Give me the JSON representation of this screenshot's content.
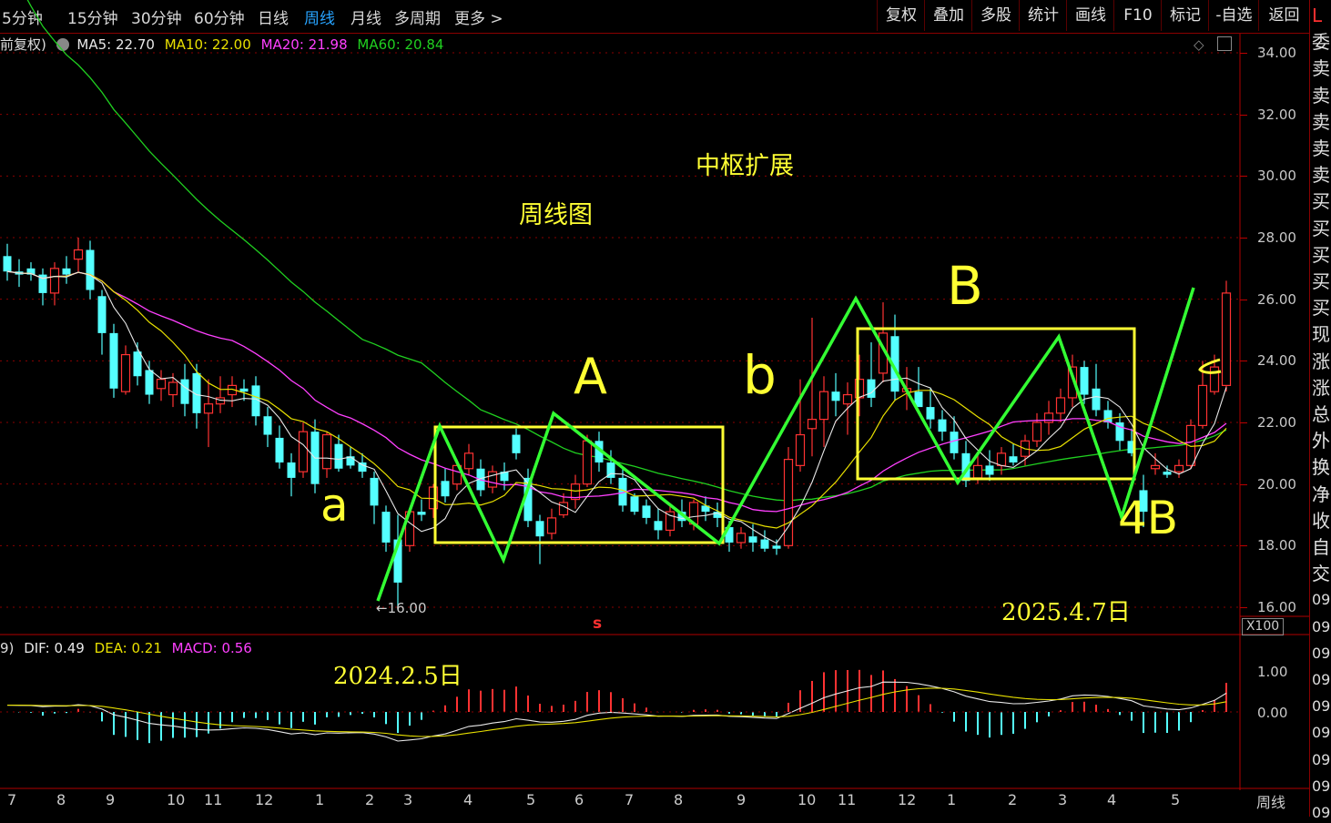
{
  "toolbar": {
    "periods": [
      {
        "label": "5分钟",
        "active": false
      },
      {
        "label": "15分钟",
        "active": false
      },
      {
        "label": "30分钟",
        "active": false
      },
      {
        "label": "60分钟",
        "active": false
      },
      {
        "label": "日线",
        "active": false
      },
      {
        "label": "周线",
        "active": true
      },
      {
        "label": "月线",
        "active": false
      },
      {
        "label": "多周期",
        "active": false
      },
      {
        "label": "更多 >",
        "active": false
      }
    ],
    "tools": [
      "复权",
      "叠加",
      "多股",
      "统计",
      "画线",
      "F10",
      "标记",
      "-自选",
      "返回"
    ]
  },
  "ma_legend": {
    "adjust_label": "前复权)",
    "ma5": "MA5: 22.70",
    "ma10": "MA10: 22.00",
    "ma20": "MA20: 21.98",
    "ma60": "MA60: 20.84"
  },
  "colors": {
    "up": "#ff3232",
    "down": "#54ffff",
    "ma5": "#e8e8e8",
    "ma10": "#e8e000",
    "ma20": "#ff40ff",
    "ma60": "#20d020",
    "grid": "#8a0000",
    "annotation_yellow": "#ffff33",
    "annotation_green": "#33ff33"
  },
  "price_axis": {
    "ticks": [
      "34.00",
      "32.00",
      "30.00",
      "28.00",
      "26.00",
      "24.00",
      "22.00",
      "20.00",
      "18.00",
      "16.00"
    ],
    "multiplier": "X100"
  },
  "low_marker": "16.00",
  "annotations": {
    "title1": "中枢扩展",
    "title2": "周线图",
    "label_A": "A",
    "label_B": "B",
    "label_a": "a",
    "label_b": "b",
    "label_c": "c",
    "label_4B": "4B",
    "date_start": "2024.2.5日",
    "date_end": "2025.4.7日",
    "s_marker": "s"
  },
  "macd": {
    "legend_prefix": "9)",
    "dif": "DIF: 0.49",
    "dea": "DEA: 0.21",
    "macd": "MACD: 0.56",
    "ticks": [
      "1.00",
      "0.00"
    ]
  },
  "x_axis": [
    "7",
    "8",
    "9",
    "10",
    "11",
    "12",
    "1",
    "2",
    "3",
    "4",
    "5",
    "6",
    "7",
    "8",
    "9",
    "10",
    "11",
    "12",
    "1",
    "2",
    "3",
    "4",
    "5"
  ],
  "period_label": "周线",
  "order_panel": [
    "L",
    "委",
    "卖",
    "卖",
    "卖",
    "卖",
    "卖",
    "买",
    "买",
    "买",
    "买",
    "买",
    "现",
    "涨",
    "涨",
    "总",
    "外",
    "换",
    "净",
    "收",
    "自",
    "交",
    "09",
    "09",
    "09",
    "09",
    "09",
    "09",
    "09",
    "09",
    "09"
  ],
  "chart_data": {
    "type": "candlestick",
    "period": "weekly",
    "ylim": [
      16,
      34
    ],
    "candles": [
      [
        27.4,
        27.8,
        26.6,
        26.9
      ],
      [
        26.9,
        27.3,
        26.4,
        26.8
      ],
      [
        27.0,
        27.2,
        26.6,
        26.8
      ],
      [
        26.8,
        27.0,
        25.8,
        26.2
      ],
      [
        26.2,
        27.2,
        25.8,
        27.0
      ],
      [
        27.0,
        27.4,
        26.5,
        26.8
      ],
      [
        27.3,
        28.0,
        26.9,
        27.6
      ],
      [
        27.6,
        27.9,
        26.0,
        26.3
      ],
      [
        26.1,
        26.3,
        24.2,
        24.9
      ],
      [
        24.9,
        25.2,
        22.8,
        23.1
      ],
      [
        23.0,
        24.5,
        22.9,
        24.2
      ],
      [
        24.3,
        24.6,
        23.2,
        23.5
      ],
      [
        23.7,
        24.0,
        22.6,
        22.9
      ],
      [
        23.1,
        23.7,
        22.7,
        23.4
      ],
      [
        22.9,
        23.6,
        22.5,
        23.3
      ],
      [
        23.4,
        23.9,
        22.2,
        22.6
      ],
      [
        23.6,
        23.9,
        21.8,
        22.3
      ],
      [
        22.3,
        23.4,
        21.2,
        22.6
      ],
      [
        22.6,
        23.5,
        22.3,
        22.8
      ],
      [
        22.9,
        23.5,
        22.5,
        23.2
      ],
      [
        23.1,
        23.4,
        22.7,
        23.0
      ],
      [
        23.2,
        23.5,
        21.9,
        22.2
      ],
      [
        22.2,
        22.5,
        21.2,
        21.6
      ],
      [
        21.5,
        21.9,
        20.5,
        20.7
      ],
      [
        20.7,
        21.0,
        19.6,
        20.2
      ],
      [
        20.4,
        22.0,
        20.2,
        21.7
      ],
      [
        21.7,
        22.1,
        19.7,
        20.0
      ],
      [
        20.5,
        21.7,
        20.2,
        21.6
      ],
      [
        21.3,
        21.6,
        20.4,
        20.5
      ],
      [
        20.9,
        21.2,
        20.5,
        20.6
      ],
      [
        20.7,
        21.0,
        20.2,
        20.4
      ],
      [
        20.2,
        20.4,
        18.7,
        19.3
      ],
      [
        19.1,
        19.3,
        17.8,
        18.1
      ],
      [
        18.2,
        19.0,
        16.0,
        16.8
      ],
      [
        18.0,
        19.2,
        17.8,
        19.1
      ],
      [
        19.1,
        19.5,
        18.8,
        19.0
      ],
      [
        19.2,
        20.0,
        18.9,
        19.9
      ],
      [
        20.1,
        20.5,
        19.4,
        19.6
      ],
      [
        20.0,
        20.8,
        19.8,
        20.6
      ],
      [
        20.5,
        21.3,
        20.3,
        21.0
      ],
      [
        20.5,
        20.8,
        19.6,
        19.8
      ],
      [
        19.9,
        20.6,
        19.7,
        20.4
      ],
      [
        20.4,
        20.7,
        19.8,
        20.1
      ],
      [
        21.6,
        21.8,
        20.8,
        21.0
      ],
      [
        20.2,
        20.5,
        18.6,
        18.8
      ],
      [
        18.8,
        19.0,
        17.4,
        18.3
      ],
      [
        18.4,
        19.2,
        18.2,
        18.9
      ],
      [
        19.0,
        19.7,
        18.9,
        19.4
      ],
      [
        19.5,
        20.3,
        19.2,
        20.0
      ],
      [
        20.0,
        21.6,
        19.9,
        21.4
      ],
      [
        21.4,
        21.7,
        20.4,
        20.7
      ],
      [
        20.7,
        21.1,
        20.0,
        20.2
      ],
      [
        20.2,
        20.5,
        19.1,
        19.3
      ],
      [
        19.6,
        19.7,
        19.0,
        19.1
      ],
      [
        19.3,
        19.5,
        18.7,
        18.9
      ],
      [
        18.8,
        19.2,
        18.2,
        18.5
      ],
      [
        18.5,
        19.3,
        18.3,
        19.1
      ],
      [
        19.1,
        19.5,
        18.6,
        18.8
      ],
      [
        18.7,
        19.5,
        18.5,
        19.4
      ],
      [
        19.3,
        19.6,
        18.8,
        19.1
      ],
      [
        19.1,
        19.4,
        18.6,
        18.9
      ],
      [
        18.6,
        18.8,
        17.8,
        18.1
      ],
      [
        18.1,
        18.6,
        17.9,
        18.4
      ],
      [
        18.3,
        18.7,
        17.8,
        18.1
      ],
      [
        18.2,
        18.5,
        17.8,
        17.9
      ],
      [
        18.0,
        18.2,
        17.7,
        17.9
      ],
      [
        18.0,
        21.2,
        17.9,
        20.8
      ],
      [
        20.6,
        23.4,
        20.4,
        21.6
      ],
      [
        21.8,
        25.4,
        20.9,
        22.1
      ],
      [
        22.1,
        23.5,
        21.2,
        23.0
      ],
      [
        23.0,
        23.6,
        22.2,
        22.7
      ],
      [
        22.6,
        23.3,
        21.6,
        22.9
      ],
      [
        22.8,
        24.2,
        22.2,
        23.4
      ],
      [
        23.4,
        24.6,
        22.5,
        22.8
      ],
      [
        23.6,
        25.9,
        23.3,
        24.9
      ],
      [
        24.8,
        25.5,
        22.7,
        23.0
      ],
      [
        23.0,
        23.8,
        22.4,
        23.1
      ],
      [
        23.0,
        23.8,
        22.6,
        22.5
      ],
      [
        22.5,
        23.1,
        21.8,
        22.1
      ],
      [
        22.1,
        22.4,
        21.4,
        21.7
      ],
      [
        21.7,
        22.2,
        20.8,
        21.0
      ],
      [
        21.0,
        21.4,
        19.9,
        20.1
      ],
      [
        20.2,
        21.0,
        20.0,
        20.6
      ],
      [
        20.6,
        21.1,
        20.1,
        20.3
      ],
      [
        20.6,
        21.2,
        20.3,
        21.0
      ],
      [
        20.9,
        21.3,
        20.6,
        20.7
      ],
      [
        20.9,
        21.6,
        20.6,
        21.4
      ],
      [
        21.4,
        22.3,
        21.2,
        22.0
      ],
      [
        22.0,
        22.7,
        21.6,
        22.3
      ],
      [
        22.3,
        23.1,
        22.0,
        22.8
      ],
      [
        22.8,
        24.2,
        22.5,
        23.8
      ],
      [
        23.8,
        24.0,
        22.6,
        22.9
      ],
      [
        23.1,
        23.9,
        22.2,
        22.4
      ],
      [
        22.4,
        22.7,
        21.8,
        22.0
      ],
      [
        22.0,
        22.3,
        21.1,
        21.4
      ],
      [
        21.4,
        21.8,
        20.9,
        21.0
      ],
      [
        19.8,
        20.3,
        18.6,
        19.1
      ],
      [
        20.5,
        21.0,
        20.3,
        20.6
      ],
      [
        20.4,
        20.6,
        20.2,
        20.3
      ],
      [
        20.4,
        20.8,
        20.2,
        20.6
      ],
      [
        20.6,
        22.1,
        20.5,
        21.9
      ],
      [
        21.9,
        24.0,
        21.8,
        23.2
      ],
      [
        23.0,
        24.2,
        22.9,
        23.8
      ],
      [
        23.2,
        26.6,
        23.0,
        26.2
      ]
    ]
  }
}
